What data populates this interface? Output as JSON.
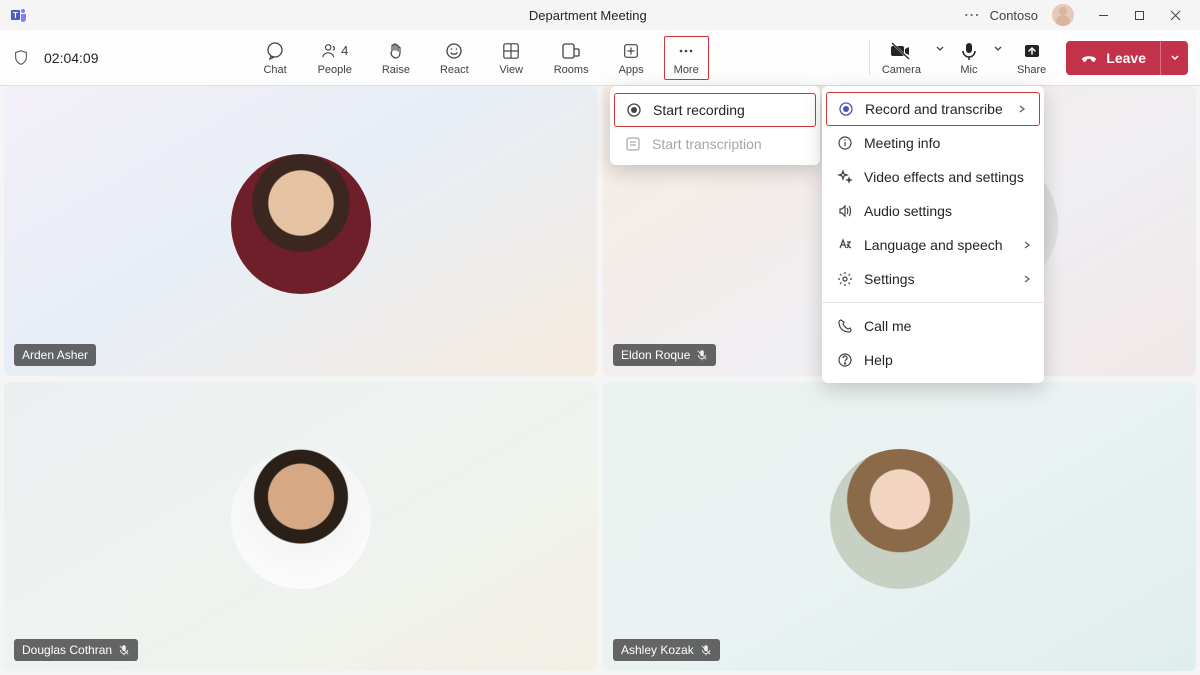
{
  "titlebar": {
    "title": "Department Meeting",
    "tenant": "Contoso"
  },
  "toolbar": {
    "timer": "02:04:09",
    "chat": "Chat",
    "people": "People",
    "people_count": "4",
    "raise": "Raise",
    "react": "React",
    "view": "View",
    "rooms": "Rooms",
    "apps": "Apps",
    "more": "More",
    "camera": "Camera",
    "mic": "Mic",
    "share": "Share",
    "leave": "Leave"
  },
  "more_menu": {
    "record": "Record and transcribe",
    "info": "Meeting info",
    "video": "Video effects and settings",
    "audio": "Audio settings",
    "lang": "Language and speech",
    "settings": "Settings",
    "callme": "Call me",
    "help": "Help"
  },
  "submenu": {
    "start_recording": "Start recording",
    "start_transcription": "Start transcription"
  },
  "participants": [
    {
      "name": "Arden Asher",
      "muted": false
    },
    {
      "name": "Eldon Roque",
      "muted": true
    },
    {
      "name": "Douglas Cothran",
      "muted": true
    },
    {
      "name": "Ashley Kozak",
      "muted": true
    }
  ]
}
